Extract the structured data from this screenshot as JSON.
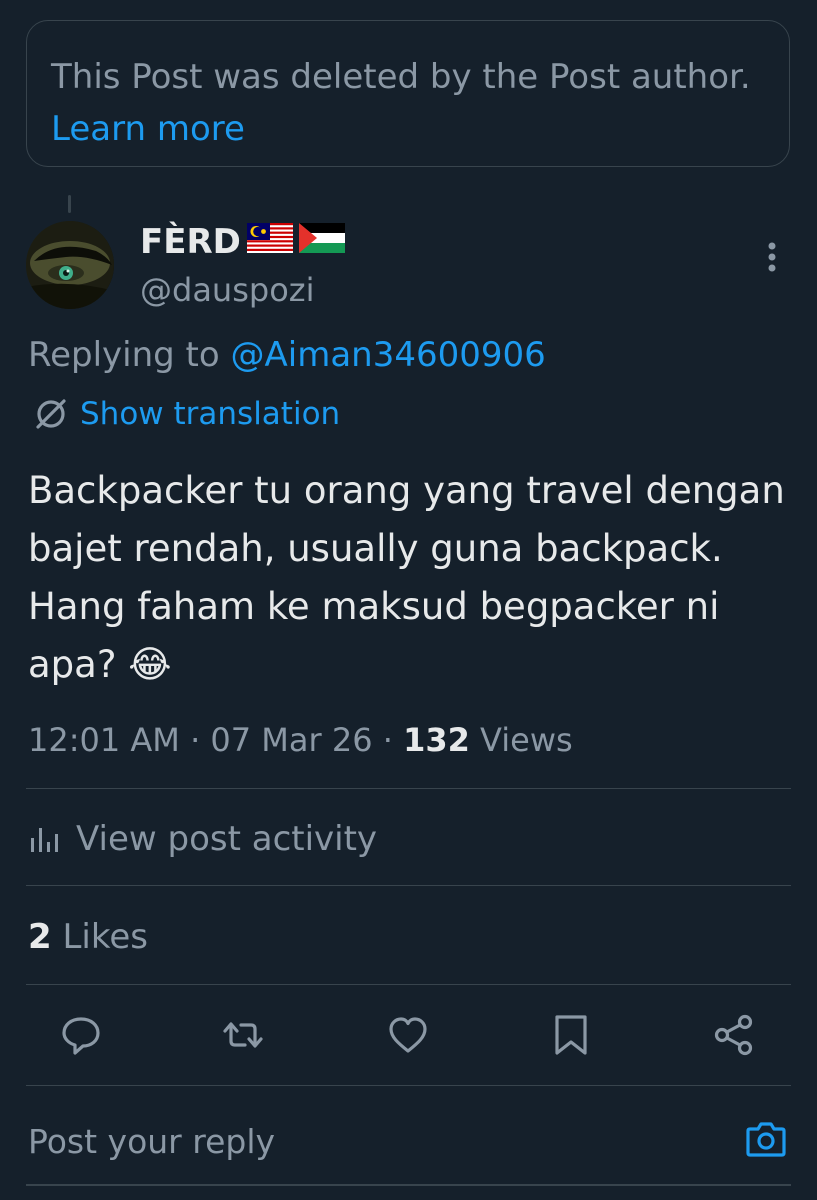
{
  "deleted_notice": {
    "text": "This Post was deleted by the Post author.",
    "link": "Learn more"
  },
  "author": {
    "display_name": "FÈRD",
    "flags": [
      "🇲🇾",
      "🇵🇸"
    ],
    "handle": "@dauspozi"
  },
  "replying": {
    "prefix": "Replying to",
    "to": "@Aiman34600906"
  },
  "translation": {
    "label": "Show translation"
  },
  "post": {
    "text": "Backpacker tu orang yang travel dengan bajet rendah, usually guna backpack. Hang faham ke maksud begpacker ni apa? 😂",
    "time": "12:01 AM",
    "date": "07 Mar 26",
    "views_count": "132",
    "views_label": "Views"
  },
  "activity": {
    "label": "View post activity"
  },
  "likes": {
    "count": "2",
    "label": "Likes"
  },
  "actions": [
    "reply",
    "repost",
    "like",
    "bookmark",
    "share"
  ],
  "reply_box": {
    "placeholder": "Post your reply"
  },
  "colors": {
    "background": "#15202b",
    "accent": "#1d9bf0",
    "text_primary": "#e7e9ea",
    "text_secondary": "#8b98a5",
    "border": "#38444d"
  }
}
